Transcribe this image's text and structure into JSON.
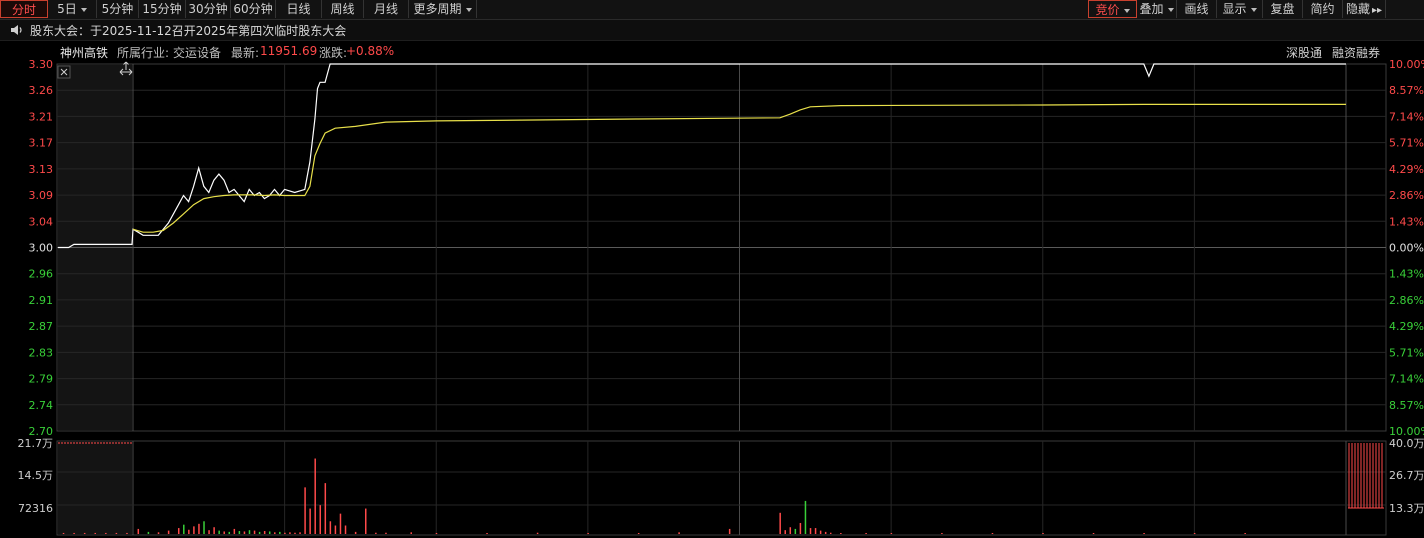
{
  "toolbar": {
    "periods": [
      {
        "label": "分时",
        "active": true,
        "caret": false
      },
      {
        "label": "5日",
        "active": false,
        "caret": true
      },
      {
        "label": "5分钟",
        "active": false,
        "caret": false
      },
      {
        "label": "15分钟",
        "active": false,
        "caret": false
      },
      {
        "label": "30分钟",
        "active": false,
        "caret": false
      },
      {
        "label": "60分钟",
        "active": false,
        "caret": false
      },
      {
        "label": "日线",
        "active": false,
        "caret": false
      },
      {
        "label": "周线",
        "active": false,
        "caret": false
      },
      {
        "label": "月线",
        "active": false,
        "caret": false
      },
      {
        "label": "更多周期",
        "active": false,
        "caret": true
      }
    ],
    "right": [
      {
        "label": "竞价",
        "highlight": true,
        "caret": true
      },
      {
        "label": "叠加",
        "highlight": false,
        "caret": true
      },
      {
        "label": "画线",
        "highlight": false,
        "caret": false
      },
      {
        "label": "显示",
        "highlight": false,
        "caret": true
      },
      {
        "label": "复盘",
        "highlight": false,
        "caret": false
      },
      {
        "label": "简约",
        "highlight": false,
        "caret": false
      },
      {
        "label": "隐藏",
        "highlight": false,
        "caret": false,
        "suffix": "▸▸"
      }
    ]
  },
  "notice": {
    "text": "股东大会：于2025-11-12召开2025年第四次临时股东大会"
  },
  "info": {
    "stock_name": "神州高铁",
    "industry_label": "所属行业:",
    "industry": "交运设备",
    "latest_label": "最新:",
    "latest": "11951.69",
    "change_label": "涨跌:",
    "change": "+0.88%",
    "links": [
      "深股通",
      "融资融券"
    ]
  },
  "colors": {
    "up": "#ff4a4a",
    "down": "#39d039",
    "neutral": "#e0e0e0",
    "price_line": "#ffffff",
    "avg_line": "#e8e04a",
    "grid": "#3a3a3a"
  },
  "chart_data": [
    {
      "type": "line",
      "price_axis": [
        "3.30",
        "3.26",
        "3.21",
        "3.17",
        "3.13",
        "3.09",
        "3.04",
        "3.00",
        "2.96",
        "2.91",
        "2.87",
        "2.83",
        "2.79",
        "2.74",
        "2.70"
      ],
      "pct_axis": [
        "10.00%",
        "8.57%",
        "7.14%",
        "5.71%",
        "4.29%",
        "2.86%",
        "1.43%",
        "0.00%",
        "1.43%",
        "2.86%",
        "4.29%",
        "5.71%",
        "7.14%",
        "8.57%",
        "10.00%"
      ],
      "ylim": [
        2.7,
        3.3
      ],
      "xlim": [
        -15,
        240
      ],
      "series": [
        {
          "key": "price",
          "x": [
            -15,
            -13,
            -12,
            -1,
            0,
            1,
            2,
            3,
            5,
            7,
            9,
            10,
            11,
            12,
            13,
            14,
            15,
            16,
            17,
            18,
            19,
            20,
            21,
            22,
            23,
            24,
            25,
            26,
            27,
            28,
            29,
            30,
            32,
            34,
            35,
            36,
            36.5,
            37,
            38,
            39,
            40,
            200,
            201,
            202,
            203,
            240
          ],
          "y": [
            3.0,
            3.0,
            3.005,
            3.005,
            3.03,
            3.025,
            3.02,
            3.02,
            3.02,
            3.04,
            3.07,
            3.085,
            3.075,
            3.1,
            3.13,
            3.1,
            3.09,
            3.11,
            3.12,
            3.11,
            3.09,
            3.095,
            3.085,
            3.075,
            3.095,
            3.085,
            3.09,
            3.08,
            3.085,
            3.095,
            3.085,
            3.095,
            3.09,
            3.095,
            3.14,
            3.21,
            3.26,
            3.27,
            3.27,
            3.3,
            3.3,
            3.3,
            3.28,
            3.3,
            3.3,
            3.3
          ]
        },
        {
          "key": "avg",
          "x": [
            0,
            2,
            4,
            6,
            8,
            10,
            12,
            14,
            16,
            18,
            20,
            22,
            24,
            26,
            28,
            30,
            32,
            34,
            35,
            36,
            37,
            38,
            40,
            44,
            50,
            60,
            100,
            128,
            130,
            132,
            134,
            140,
            180,
            200,
            240
          ],
          "y": [
            3.03,
            3.025,
            3.025,
            3.028,
            3.04,
            3.055,
            3.07,
            3.08,
            3.083,
            3.085,
            3.086,
            3.086,
            3.086,
            3.085,
            3.086,
            3.085,
            3.085,
            3.085,
            3.1,
            3.15,
            3.17,
            3.187,
            3.195,
            3.198,
            3.205,
            3.207,
            3.21,
            3.212,
            3.218,
            3.225,
            3.23,
            3.232,
            3.233,
            3.234,
            3.234
          ]
        }
      ]
    },
    {
      "type": "bar",
      "left_axis": [
        "21.7万",
        "14.5万",
        "72316"
      ],
      "right_axis": [
        "40.0万",
        "26.7万",
        "13.3万"
      ],
      "ylim": [
        0,
        217000
      ],
      "xlim": [
        -15,
        240
      ],
      "x": [
        -14,
        -12,
        -10,
        -8,
        -6,
        -4,
        -2,
        1,
        3,
        5,
        7,
        9,
        10,
        11,
        12,
        13,
        14,
        15,
        16,
        17,
        18,
        19,
        20,
        21,
        22,
        23,
        24,
        25,
        26,
        27,
        28,
        29,
        30,
        31,
        32,
        33,
        34,
        35,
        36,
        37,
        38,
        39,
        40,
        41,
        42,
        44,
        46,
        48,
        50,
        55,
        60,
        70,
        80,
        90,
        100,
        108,
        118,
        128,
        129,
        130,
        131,
        132,
        133,
        134,
        135,
        136,
        137,
        138,
        140,
        145,
        150,
        160,
        170,
        180,
        190,
        200,
        210,
        220
      ],
      "volume": [
        2500,
        2500,
        2500,
        2500,
        2500,
        2500,
        2500,
        12000,
        5000,
        4000,
        8000,
        14000,
        22000,
        10000,
        18000,
        24000,
        30000,
        9000,
        16000,
        8000,
        6000,
        5000,
        12000,
        7000,
        6000,
        9000,
        8000,
        5000,
        7000,
        6000,
        4000,
        5000,
        3000,
        4000,
        3000,
        4000,
        110000,
        60000,
        178000,
        68000,
        120000,
        30000,
        20000,
        48000,
        20000,
        5000,
        60000,
        3000,
        3000,
        4000,
        2000,
        2000,
        3000,
        2000,
        2000,
        4000,
        12000,
        50000,
        9000,
        16000,
        12000,
        26000,
        78000,
        14000,
        14000,
        8000,
        5000,
        3000,
        2000,
        2000,
        1500,
        1500,
        1500,
        1500,
        1500,
        1500,
        1500,
        1500
      ],
      "dir": [
        "u",
        "u",
        "u",
        "u",
        "u",
        "u",
        "u",
        "u",
        "d",
        "u",
        "u",
        "u",
        "d",
        "u",
        "u",
        "u",
        "d",
        "u",
        "u",
        "d",
        "u",
        "d",
        "u",
        "d",
        "u",
        "d",
        "u",
        "d",
        "u",
        "d",
        "u",
        "d",
        "u",
        "u",
        "u",
        "u",
        "u",
        "u",
        "u",
        "u",
        "u",
        "u",
        "u",
        "u",
        "u",
        "u",
        "u",
        "u",
        "u",
        "u",
        "u",
        "u",
        "u",
        "u",
        "u",
        "u",
        "u",
        "u",
        "u",
        "u",
        "d",
        "u",
        "d",
        "u",
        "u",
        "u",
        "u",
        "u",
        "u",
        "u",
        "u",
        "u",
        "u",
        "u",
        "u",
        "u",
        "u",
        "u"
      ]
    }
  ]
}
